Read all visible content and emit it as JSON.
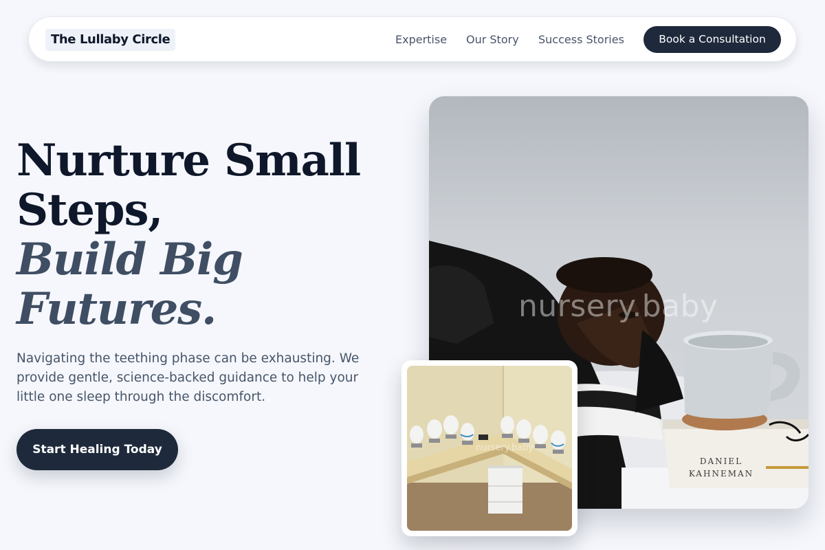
{
  "nav": {
    "logo": "The Lullaby Circle",
    "links": [
      "Expertise",
      "Our Story",
      "Success Stories"
    ],
    "cta": "Book a Consultation"
  },
  "hero": {
    "headline_line1": "Nurture Small",
    "headline_line2": "Steps,",
    "headline_italic_line1": "Build Big",
    "headline_italic_line2": "Futures.",
    "subtext": "Navigating the teething phase can be exhausting. We provide gentle, science-backed guidance to help your little one sleep through the discomfort.",
    "cta": "Start Healing Today"
  },
  "images": {
    "main_watermark": "nursery.baby",
    "book_author_line1": "DANIEL",
    "book_author_line2": "KAHNEMAN",
    "inset_watermark": "nursery.baby"
  },
  "colors": {
    "background": "#f5f7fc",
    "primary_dark": "#1e293b",
    "heading": "#0f172a",
    "heading_italic": "#3f4e63",
    "body_text": "#475569"
  }
}
